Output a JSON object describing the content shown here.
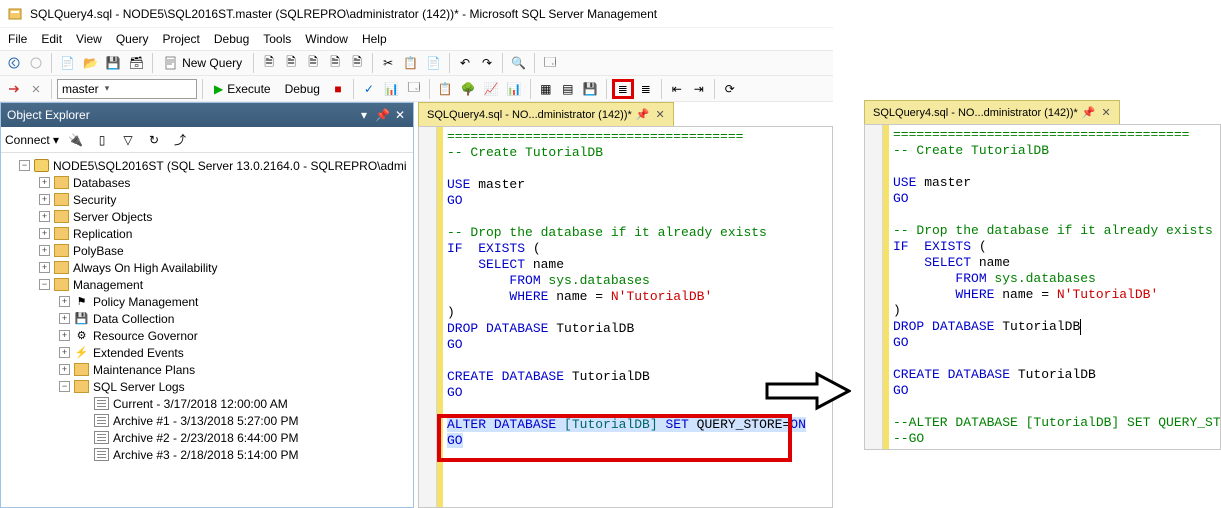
{
  "title": "SQLQuery4.sql - NODE5\\SQL2016ST.master (SQLREPRO\\administrator (142))* - Microsoft SQL Server Management",
  "menu": [
    "File",
    "Edit",
    "View",
    "Query",
    "Project",
    "Debug",
    "Tools",
    "Window",
    "Help"
  ],
  "toolbar1": {
    "new_query": "New Query"
  },
  "toolbar2": {
    "db_combo": "master",
    "execute": "Execute",
    "debug": "Debug"
  },
  "object_explorer": {
    "title": "Object Explorer",
    "connect": "Connect",
    "root": "NODE5\\SQL2016ST (SQL Server 13.0.2164.0 - SQLREPRO\\admi",
    "children": [
      {
        "label": "Databases",
        "icon": "folder",
        "expander": "+",
        "indent": 2
      },
      {
        "label": "Security",
        "icon": "folder",
        "expander": "+",
        "indent": 2
      },
      {
        "label": "Server Objects",
        "icon": "folder",
        "expander": "+",
        "indent": 2
      },
      {
        "label": "Replication",
        "icon": "folder",
        "expander": "+",
        "indent": 2
      },
      {
        "label": "PolyBase",
        "icon": "folder",
        "expander": "+",
        "indent": 2
      },
      {
        "label": "Always On High Availability",
        "icon": "folder",
        "expander": "+",
        "indent": 2
      },
      {
        "label": "Management",
        "icon": "folder",
        "expander": "-",
        "indent": 2
      },
      {
        "label": "Policy Management",
        "icon": "policy",
        "expander": "+",
        "indent": 3
      },
      {
        "label": "Data Collection",
        "icon": "data",
        "expander": "+",
        "indent": 3
      },
      {
        "label": "Resource Governor",
        "icon": "rg",
        "expander": "+",
        "indent": 3
      },
      {
        "label": "Extended Events",
        "icon": "xe",
        "expander": "+",
        "indent": 3
      },
      {
        "label": "Maintenance Plans",
        "icon": "folder",
        "expander": "+",
        "indent": 3
      },
      {
        "label": "SQL Server Logs",
        "icon": "folder",
        "expander": "-",
        "indent": 3
      },
      {
        "label": "Current - 3/17/2018 12:00:00 AM",
        "icon": "log",
        "expander": "",
        "indent": 4
      },
      {
        "label": "Archive #1 - 3/13/2018 5:27:00 PM",
        "icon": "log",
        "expander": "",
        "indent": 4
      },
      {
        "label": "Archive #2 - 2/23/2018 6:44:00 PM",
        "icon": "log",
        "expander": "",
        "indent": 4
      },
      {
        "label": "Archive #3 - 2/18/2018 5:14:00 PM",
        "icon": "log",
        "expander": "",
        "indent": 4
      }
    ]
  },
  "tab": {
    "label": "SQLQuery4.sql - NO...dministrator (142))*"
  },
  "code_left": {
    "l1": "======================================",
    "l2": "-- Create TutorialDB",
    "l3": "USE",
    "l3b": " master",
    "l4": "GO",
    "l5": "-- Drop the database if it already exists",
    "l6": "IF",
    "l6b": "  EXISTS ",
    "l6c": "(",
    "l7a": "    SELECT",
    "l7b": " name",
    "l8a": "        FROM",
    "l8b": " sys.databases",
    "l9a": "        WHERE",
    "l9b": " name ",
    "l9c": "=",
    "l9d": " N'TutorialDB'",
    "l10": ")",
    "l11a": "DROP",
    "l11b": " DATABASE",
    "l11c": " TutorialDB",
    "l12": "GO",
    "l13a": "CREATE",
    "l13b": " DATABASE",
    "l13c": " TutorialDB",
    "l14": "GO",
    "l15a": "ALTER",
    "l15b": " DATABASE",
    "l15c": " [TutorialDB] ",
    "l15d": "SET",
    "l15e": " QUERY_STORE",
    "l15f": "=",
    "l15g": "ON",
    "l16": "GO"
  },
  "code_right": {
    "l1": "======================================",
    "l2": "-- Create TutorialDB",
    "l3": "USE",
    "l3b": " master",
    "l4": "GO",
    "l5": "-- Drop the database if it already exists",
    "l6": "IF",
    "l6b": "  EXISTS ",
    "l6c": "(",
    "l7a": "    SELECT",
    "l7b": " name",
    "l8a": "        FROM",
    "l8b": " sys.databases",
    "l9a": "        WHERE",
    "l9b": " name ",
    "l9c": "=",
    "l9d": " N'TutorialDB'",
    "l10": ")",
    "l11a": "DROP",
    "l11b": " DATABASE",
    "l11c": " TutorialDB",
    "l12": "GO",
    "l13a": "CREATE",
    "l13b": " DATABASE",
    "l13c": " TutorialDB",
    "l14": "GO",
    "l15": "--ALTER DATABASE [TutorialDB] SET QUERY_STORE=ON",
    "l16": "--GO"
  }
}
